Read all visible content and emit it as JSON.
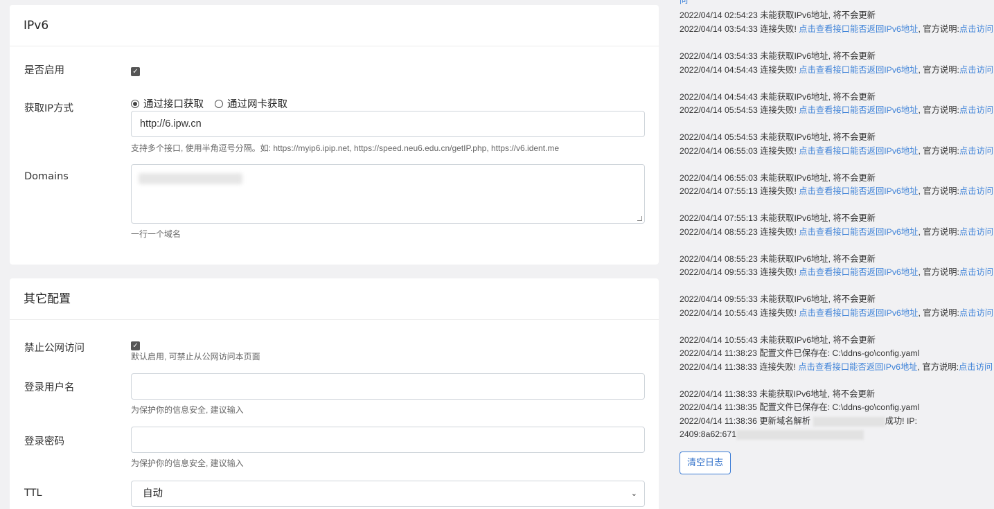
{
  "ipv6": {
    "title": "IPv6",
    "enable_label": "是否启用",
    "enable_checked": true,
    "method_label": "获取IP方式",
    "method_options": [
      "通过接口获取",
      "通过网卡获取"
    ],
    "method_selected": "通过接口获取",
    "url_value": "http://6.ipw.cn",
    "url_help": "支持多个接口, 使用半角逗号分隔。如: https://myip6.ipip.net, https://speed.neu6.edu.cn/getIP.php, https://v6.ident.me",
    "domains_label": "Domains",
    "domains_help": "一行一个域名"
  },
  "other": {
    "title": "其它配置",
    "public_label": "禁止公网访问",
    "public_checked": true,
    "public_help": "默认启用, 可禁止从公网访问本页面",
    "username_label": "登录用户名",
    "username_value": "",
    "username_help": "为保护你的信息安全, 建议输入",
    "password_label": "登录密码",
    "password_value": "",
    "password_help": "为保护你的信息安全, 建议输入",
    "ttl_label": "TTL",
    "ttl_value": "自动"
  },
  "log": {
    "top_fragment": "问",
    "no_ipv6_text": "未能获取IPv6地址, 将不会更新",
    "fail_text": "连接失败!",
    "fail_link": "点击查看接口能否返回IPv6地址",
    "official_text": "官方说明:",
    "official_link": "点击访问",
    "times": [
      "2022/04/14 02:54:23",
      "2022/04/14 03:54:33",
      "2022/04/14 03:54:33",
      "2022/04/14 04:54:43",
      "2022/04/14 04:54:43",
      "2022/04/14 05:54:53",
      "2022/04/14 05:54:53",
      "2022/04/14 06:55:03",
      "2022/04/14 06:55:03",
      "2022/04/14 07:55:13",
      "2022/04/14 07:55:13",
      "2022/04/14 08:55:23",
      "2022/04/14 08:55:23",
      "2022/04/14 09:55:33",
      "2022/04/14 09:55:33",
      "2022/04/14 10:55:43",
      "2022/04/14 10:55:43",
      "2022/04/14 11:38:23",
      "2022/04/14 11:38:33",
      "2022/04/14 11:38:33",
      "2022/04/14 11:38:35",
      "2022/04/14 11:38:36"
    ],
    "config_saved": "配置文件已保存在: C:\\ddns-go\\config.yaml",
    "update_prefix": "更新域名解析",
    "update_suffix": "成功! IP:",
    "ip_prefix": "2409:8a62:671",
    "clear_button": "清空日志"
  }
}
